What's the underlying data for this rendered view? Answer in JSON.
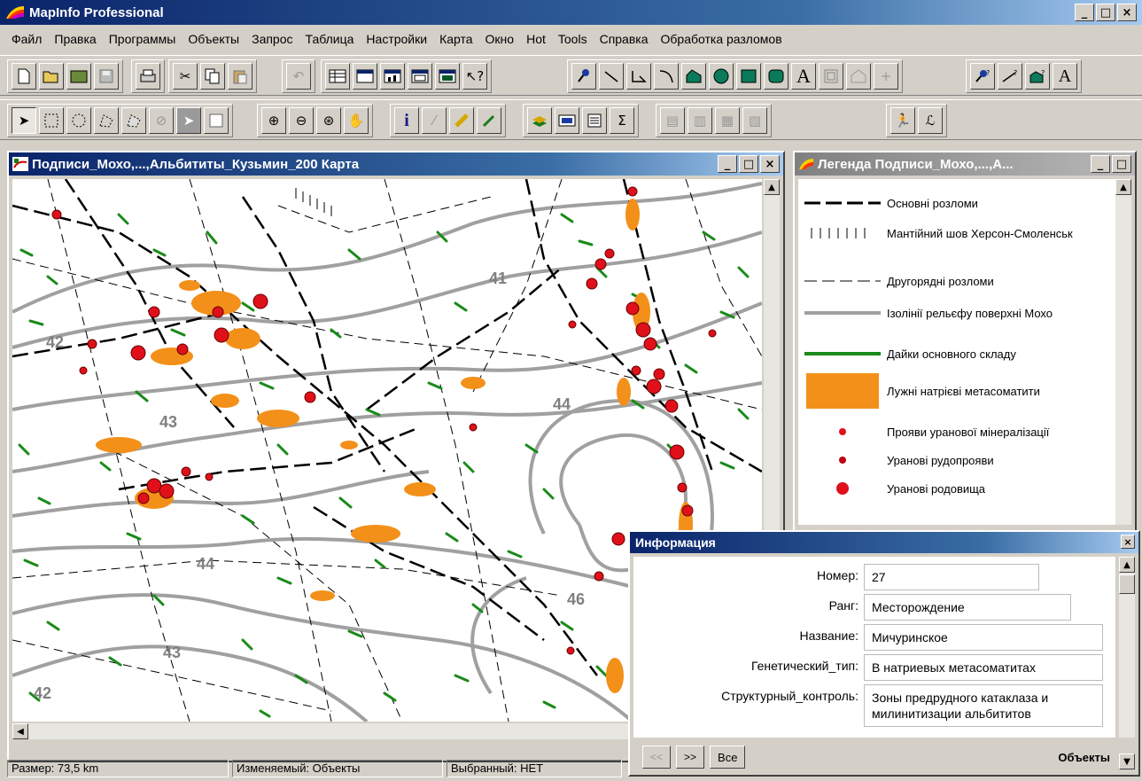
{
  "app": {
    "title": "MapInfo Professional",
    "window_buttons": [
      "_",
      "□",
      "×"
    ]
  },
  "menu": [
    "Файл",
    "Правка",
    "Программы",
    "Объекты",
    "Запрос",
    "Таблица",
    "Настройки",
    "Карта",
    "Окно",
    "Hot",
    "Tools",
    "Справка",
    "Обработка разломов"
  ],
  "toolbar1": {
    "groups": [
      [
        "new-icon",
        "open-icon",
        "open-workspace-icon",
        "save-icon"
      ],
      [
        "print-icon"
      ],
      [
        "cut-icon",
        "copy-icon",
        "paste-icon"
      ],
      [
        "undo-icon"
      ],
      [
        "browser-icon",
        "map-window-icon",
        "graph-icon",
        "layout-icon",
        "redistrict-icon",
        "help-pointer-icon"
      ],
      [
        "symbol-icon",
        "line-icon",
        "polyline-icon",
        "arc-icon",
        "polygon-icon",
        "ellipse-icon",
        "rectangle-icon",
        "rounded-rect-icon",
        "text-icon",
        "frame-icon",
        "reshape-icon",
        "add-node-icon"
      ],
      [
        "symbol-style-icon",
        "line-style-icon",
        "region-style-icon",
        "text-style-icon"
      ]
    ],
    "text_glyph": "A"
  },
  "toolbar2": {
    "groups": [
      [
        "select-icon",
        "marquee-select-icon",
        "radius-select-icon",
        "polygon-select-icon",
        "boundary-select-icon",
        "unselect-icon",
        "invert-select-icon",
        "graph-select-icon"
      ],
      [
        "zoom-in-icon",
        "zoom-out-icon",
        "change-view-icon",
        "grabber-icon"
      ],
      [
        "info-icon",
        "hotlink-icon",
        "label-icon",
        "drag-window-icon"
      ],
      [
        "layer-control-icon",
        "ruler-icon",
        "legend-icon",
        "statistics-icon"
      ],
      [
        "clip-region-icon",
        "set-clip-icon",
        "show-legend-icon",
        "map-options-icon"
      ],
      [
        "run-icon",
        "signature-icon"
      ]
    ],
    "info_glyph": "i",
    "sum_glyph": "Σ"
  },
  "map_window": {
    "title": "Подписи_Мохо,...,Альбититы_Кузьмин_200 Карта",
    "contour_labels": [
      "41",
      "42",
      "43",
      "44",
      "44",
      "43",
      "42",
      "46"
    ],
    "colors": {
      "contour": "#9a9a9a",
      "dike": "#1a8a1a",
      "metasomatite": "#f39019",
      "deposit": "#e0101a",
      "fault": "#000000"
    }
  },
  "legend_window": {
    "title": "Легенда Подписи_Мохо,...,А...",
    "items": [
      {
        "symbol": "major-fault",
        "label": "Основні розломи"
      },
      {
        "symbol": "mantle-suture",
        "label": "Мантійний шов Херсон-Смоленськ"
      },
      {
        "symbol": "minor-fault",
        "label": "Другорядні розломи"
      },
      {
        "symbol": "moho-isoline",
        "label": "Ізолінії рельєфу поверхні Мохо"
      },
      {
        "symbol": "dike",
        "label": "Дайки основного складу"
      },
      {
        "symbol": "metasomatite",
        "label": "Лужні натрієві метасоматити"
      },
      {
        "symbol": "occurrence-small",
        "label": "Прояви уранової мінералізації"
      },
      {
        "symbol": "occurrence-medium",
        "label": "Уранові рудопрояви"
      },
      {
        "symbol": "deposit-large",
        "label": "Уранові родовища"
      }
    ]
  },
  "info_window": {
    "title": "Информация",
    "fields": [
      {
        "label": "Номер:",
        "value": "27"
      },
      {
        "label": "Ранг:",
        "value": "Месторождение"
      },
      {
        "label": "Название:",
        "value": "Мичуринское"
      },
      {
        "label": "Генетический_тип:",
        "value": "В натриевых метасоматитах"
      },
      {
        "label": "Структурный_контроль:",
        "value": "Зоны предрудного катаклаза и милинитизации альбититов"
      }
    ],
    "buttons": {
      "prev": "<<",
      "next": ">>",
      "all": "Все"
    },
    "footer_label": "Объекты"
  },
  "status": {
    "size": "Размер: 73,5 km",
    "editable": "Изменяемый: Объекты",
    "selected": "Выбранный: НЕТ"
  }
}
